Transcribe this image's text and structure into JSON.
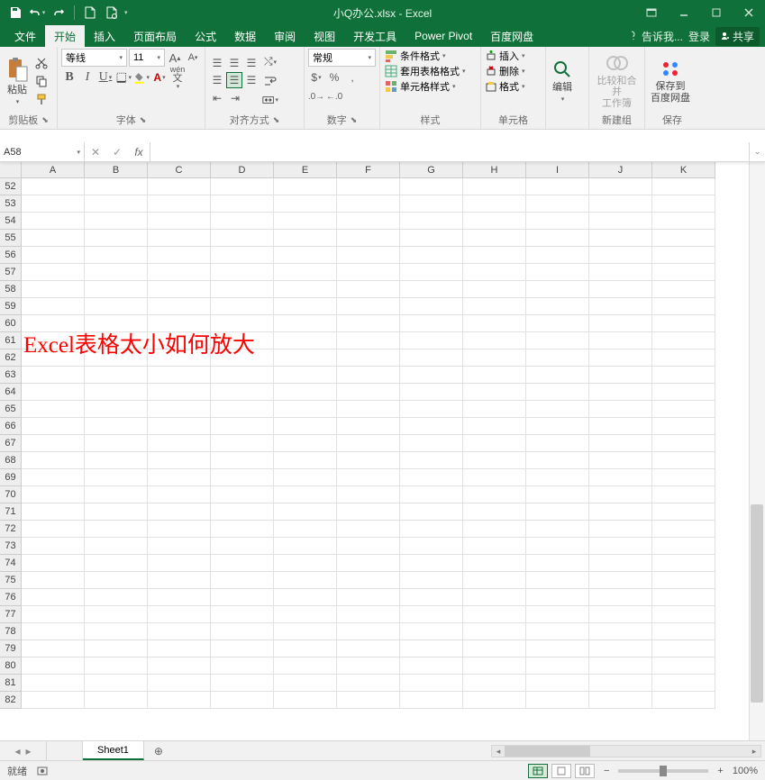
{
  "title": "小Q办公.xlsx - Excel",
  "qat": {
    "save": "save",
    "undo": "undo",
    "redo": "redo",
    "new": "new",
    "open": "open"
  },
  "tabs": [
    "文件",
    "开始",
    "插入",
    "页面布局",
    "公式",
    "数据",
    "审阅",
    "视图",
    "开发工具",
    "Power Pivot",
    "百度网盘"
  ],
  "tell_me": "告诉我...",
  "login": "登录",
  "share": "共享",
  "ribbon": {
    "clipboard": {
      "label": "剪贴板",
      "paste": "粘贴"
    },
    "font": {
      "label": "字体",
      "name": "等线",
      "size": "11"
    },
    "align": {
      "label": "对齐方式",
      "wrap": "自动换行",
      "merge": "合并后居中"
    },
    "number": {
      "label": "数字",
      "format": "常规"
    },
    "styles": {
      "label": "样式",
      "cond": "条件格式",
      "table": "套用表格格式",
      "cell": "单元格样式"
    },
    "cells": {
      "label": "单元格",
      "insert": "插入",
      "delete": "删除",
      "format": "格式"
    },
    "editing": {
      "label": "编辑",
      "btn": "编辑"
    },
    "compare": {
      "label": "新建组",
      "btn1": "比较和合并",
      "btn2": "工作簿"
    },
    "save": {
      "label": "保存",
      "btn1": "保存到",
      "btn2": "百度网盘"
    }
  },
  "namebox": {
    "ref": "A58"
  },
  "columns": [
    "A",
    "B",
    "C",
    "D",
    "E",
    "F",
    "G",
    "H",
    "I",
    "J",
    "K"
  ],
  "row_start": 52,
  "row_end": 82,
  "banner": {
    "row": 61,
    "text": "Excel表格太小如何放大"
  },
  "sheet": {
    "name": "Sheet1"
  },
  "status": {
    "ready": "就绪",
    "zoom": "100%"
  }
}
